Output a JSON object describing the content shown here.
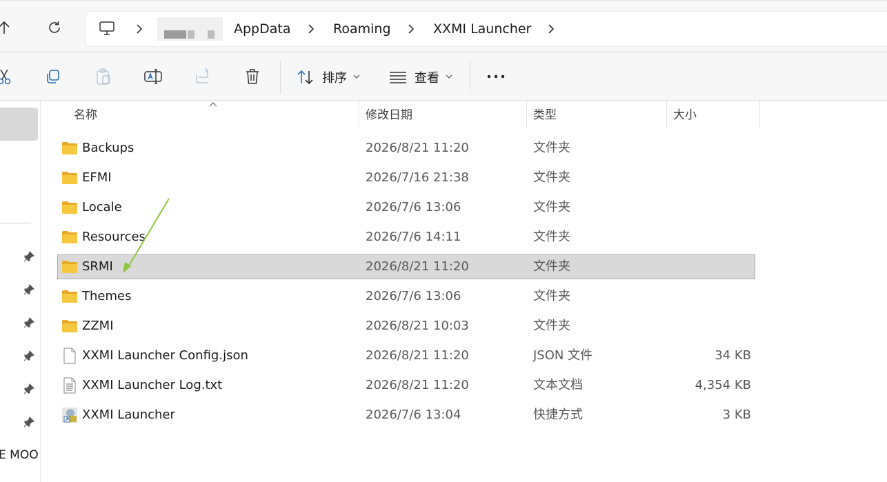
{
  "address": {
    "crumbs": [
      "AppData",
      "Roaming",
      "XXMI Launcher"
    ]
  },
  "toolbar": {
    "sort_label": "排序",
    "view_label": "查看"
  },
  "sidebar": {
    "partial_label": "E MOO"
  },
  "columns": {
    "name": "名称",
    "modified": "修改日期",
    "type": "类型",
    "size": "大小"
  },
  "files": [
    {
      "name": "Backups",
      "modified": "2026/8/21 11:20",
      "type": "文件夹",
      "size": "",
      "icon": "folder-icon"
    },
    {
      "name": "EFMI",
      "modified": "2026/7/16 21:38",
      "type": "文件夹",
      "size": "",
      "icon": "folder-icon"
    },
    {
      "name": "Locale",
      "modified": "2026/7/6 13:06",
      "type": "文件夹",
      "size": "",
      "icon": "folder-icon"
    },
    {
      "name": "Resources",
      "modified": "2026/7/6 14:11",
      "type": "文件夹",
      "size": "",
      "icon": "folder-icon"
    },
    {
      "name": "SRMI",
      "modified": "2026/8/21 11:20",
      "type": "文件夹",
      "size": "",
      "icon": "folder-icon",
      "selected": true
    },
    {
      "name": "Themes",
      "modified": "2026/7/6 13:06",
      "type": "文件夹",
      "size": "",
      "icon": "folder-icon"
    },
    {
      "name": "ZZMI",
      "modified": "2026/8/21 10:03",
      "type": "文件夹",
      "size": "",
      "icon": "folder-icon"
    },
    {
      "name": "XXMI Launcher Config.json",
      "modified": "2026/8/21 11:20",
      "type": "JSON 文件",
      "size": "34 KB",
      "icon": "json-file-icon"
    },
    {
      "name": "XXMI Launcher Log.txt",
      "modified": "2026/8/21 11:20",
      "type": "文本文档",
      "size": "4,354 KB",
      "icon": "text-file-icon"
    },
    {
      "name": "XXMI Launcher",
      "modified": "2026/7/6 13:04",
      "type": "快捷方式",
      "size": "3 KB",
      "icon": "shortcut-icon"
    }
  ],
  "colors": {
    "selection": "#d9d9d9",
    "folder": "#f6c83f",
    "annotation_arrow": "#8cc63f"
  }
}
